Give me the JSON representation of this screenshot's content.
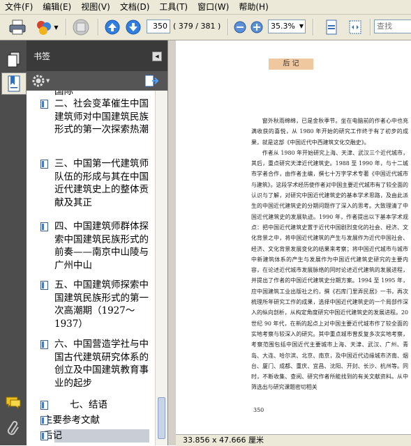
{
  "menu": [
    "文件(F)",
    "编辑(E)",
    "视图(V)",
    "文档(D)",
    "工具(T)",
    "窗口(W)",
    "帮助(H)"
  ],
  "toolbar": {
    "page_current": "350",
    "page_total": "( 379 / 381 )",
    "zoom": "35.3%",
    "search_placeholder": "查找"
  },
  "sidebar": {
    "title": "书签",
    "bookmarks": [
      "二、社会变革催生中国建筑师对中国建筑民族形式的第一次探索热潮",
      "三、中国第一代建筑师队伍的形成与其在中国近代建筑史上的整体贡献及其正",
      "四、中国建筑师群体探索中国建筑民族形式的前奏——南京中山陵与广州中山",
      "五、中国建筑师探索中国建筑民族形式的第一次高潮期（1927～1937）",
      "六、中国营造学社与中国古代建筑研究体系的创立及中国建筑教育事业的起步",
      "七、结语",
      "主要参考文献",
      "后记"
    ]
  },
  "document": {
    "heading": "后 记",
    "page_number": "350",
    "paragraphs": [
      "窗外秋雨绵绵，已是金秋季节。坐在电脑前的作者心中也充满收获的喜悦，从 1980 年开始的研究工作终于有了初步的成果，就是这部《中国近代中西建筑文化交融史》。",
      "作者从 1980 年开始研究上海、天津、武汉三个近代城市，其后，重点研究天津近代建筑史。1988 至 1990 年，与十二城市学者合作，由作者主编，撰七十万字学术专著《中国近代城市与建筑》。这段学术经历使作者对中国主要近代城市有了较全面的认识与了解，对研究中国近代建筑史的基本学术思路，及由此派生的中国近代建筑史的分期问题作了深入的思考。大致理清了中国近代建筑史的发展轨迹。1990 年，作者提出以下基本学术观点：把中国近代建筑史置于近代中国剧烈变化的社会、经济、文化背景之中，将中国近代建筑的产生与发展作为近代中国社会、经济、文化背景发展变化的结果来考察；将中国近代城市与城市中新建筑体系的产生与发展作为中国近代建筑史研究的主要内容，在论述近代城市发展脉络的同时论述近代建筑的发展进程，并提出了作者的中国近代建筑史分期方案。1994 至 1995 年，应中国建筑工业出版社之约，撰《石库门里弄民居》一书，再次梳理所年研究工作的成果，选择中国近代建筑史的一个局部作深入的纵向剖析，从构定角度研究中国近代建筑史的发展进程。20 世纪 90 年代，在新的起点上对中国主要近代城市作了较全面的实地考察与较深入的研究。其中重点城市曾反复多次实地考察，考察范围包括中国近代主要城市上海、天津、武汉、广州、青岛、大连、哈尔滨、北京、南京，及中国近代边缘城市济南、烟台、厦门、成都、重庆、宜昌、沈阳、开封、长沙、杭州等。同时，不断收集、查阅、研究作者所能找到的有关文献资料。从中筛选出与研究课题密切相关"
    ]
  },
  "status": {
    "page_size": "33.856 x 47.666 厘米"
  },
  "colors": {
    "chrome": "#ece9d8",
    "dark_panel": "#3a3a3a",
    "nav_blue": "#2f7ee0",
    "heading_tag": "#f0c8a0",
    "selected_bookmark": "#c9ced6"
  }
}
